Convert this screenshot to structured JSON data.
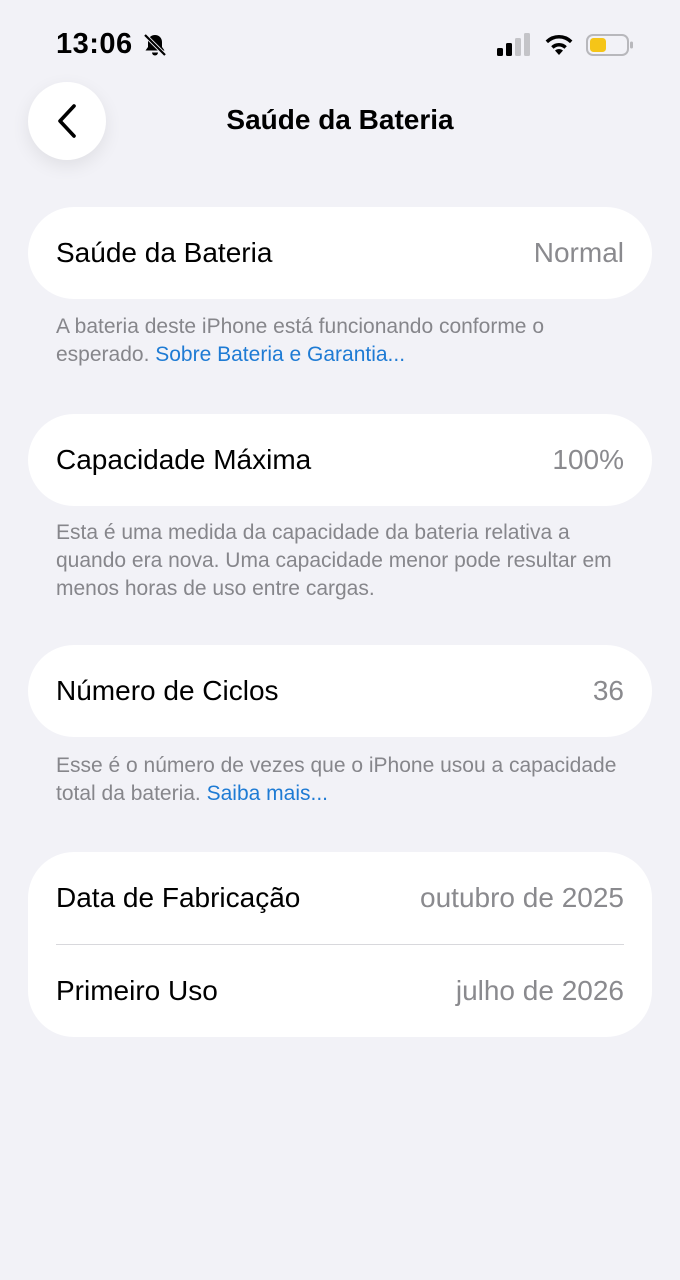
{
  "status_bar": {
    "time": "13:06",
    "icons": [
      "bell-slash-icon",
      "cellular-signal-icon",
      "wifi-icon",
      "battery-icon"
    ],
    "battery_color": "#f5c518"
  },
  "nav": {
    "title": "Saúde da Bateria",
    "back_icon": "chevron-left-icon"
  },
  "battery_health": {
    "label": "Saúde da Bateria",
    "value": "Normal",
    "footnote_text": "A bateria deste iPhone está funcionando conforme o esperado.",
    "footnote_link": "Sobre Bateria e Garantia..."
  },
  "max_capacity": {
    "label": "Capacidade Máxima",
    "value": "100%",
    "footnote_text": "Esta é uma medida da capacidade da bateria relativa a quando era nova. Uma capacidade menor pode resultar em menos horas de uso entre cargas."
  },
  "cycle_count": {
    "label": "Número de Ciclos",
    "value": "36",
    "footnote_text": "Esse é o número de vezes que o iPhone usou a capacidade total da bateria.",
    "footnote_link": "Saiba mais..."
  },
  "dates": {
    "manufacture_label": "Data de Fabricação",
    "manufacture_value": "outubro de 2025",
    "first_use_label": "Primeiro Uso",
    "first_use_value": "julho de 2026"
  },
  "colors": {
    "background": "#f2f2f7",
    "link": "#1e7bd4",
    "secondary_text": "#8a8a8e"
  }
}
